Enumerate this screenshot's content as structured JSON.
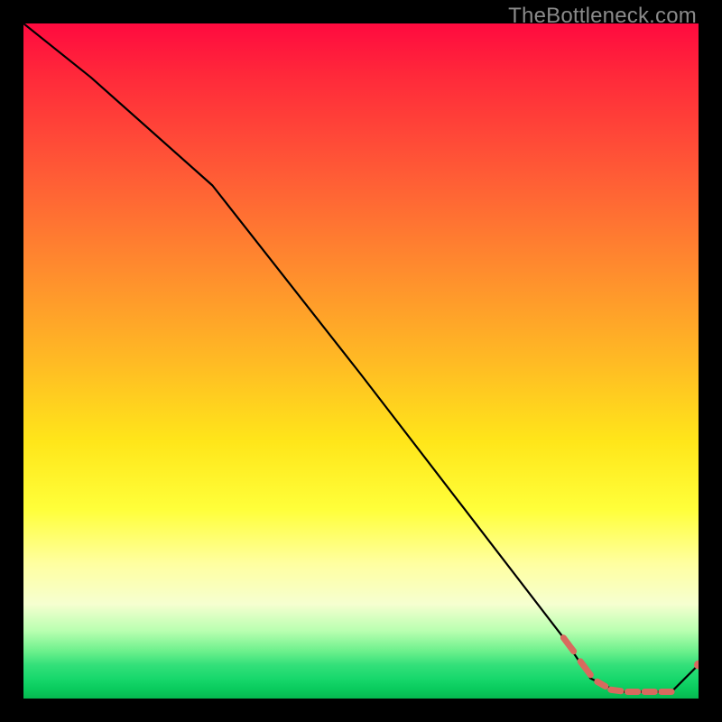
{
  "watermark": "TheBottleneck.com",
  "colors": {
    "black": "#000000",
    "curve": "#000000",
    "marker": "#d86a5e"
  },
  "chart_data": {
    "type": "line",
    "title": "",
    "xlabel": "",
    "ylabel": "",
    "xlim": [
      0,
      100
    ],
    "ylim": [
      0,
      100
    ],
    "grid": false,
    "series": [
      {
        "name": "bottleneck-curve",
        "x": [
          0,
          10,
          28,
          50,
          70,
          80,
          84,
          88,
          92,
          96,
          100
        ],
        "y": [
          100,
          92,
          76,
          48,
          22,
          9,
          3,
          1,
          1,
          1,
          5
        ]
      }
    ],
    "markers": {
      "name": "optimal-region-dashes",
      "segments": [
        {
          "x0": 80.0,
          "y0": 9.0,
          "x1": 81.5,
          "y1": 7.0
        },
        {
          "x0": 82.5,
          "y0": 5.5,
          "x1": 84.0,
          "y1": 3.5
        },
        {
          "x0": 85.0,
          "y0": 2.5,
          "x1": 86.2,
          "y1": 1.8
        },
        {
          "x0": 87.0,
          "y0": 1.3,
          "x1": 88.5,
          "y1": 1.1
        },
        {
          "x0": 89.5,
          "y0": 1.0,
          "x1": 91.0,
          "y1": 1.0
        },
        {
          "x0": 92.0,
          "y0": 1.0,
          "x1": 93.5,
          "y1": 1.0
        },
        {
          "x0": 94.5,
          "y0": 1.0,
          "x1": 96.0,
          "y1": 1.0
        }
      ],
      "end_point": {
        "x": 100,
        "y": 5
      }
    }
  }
}
